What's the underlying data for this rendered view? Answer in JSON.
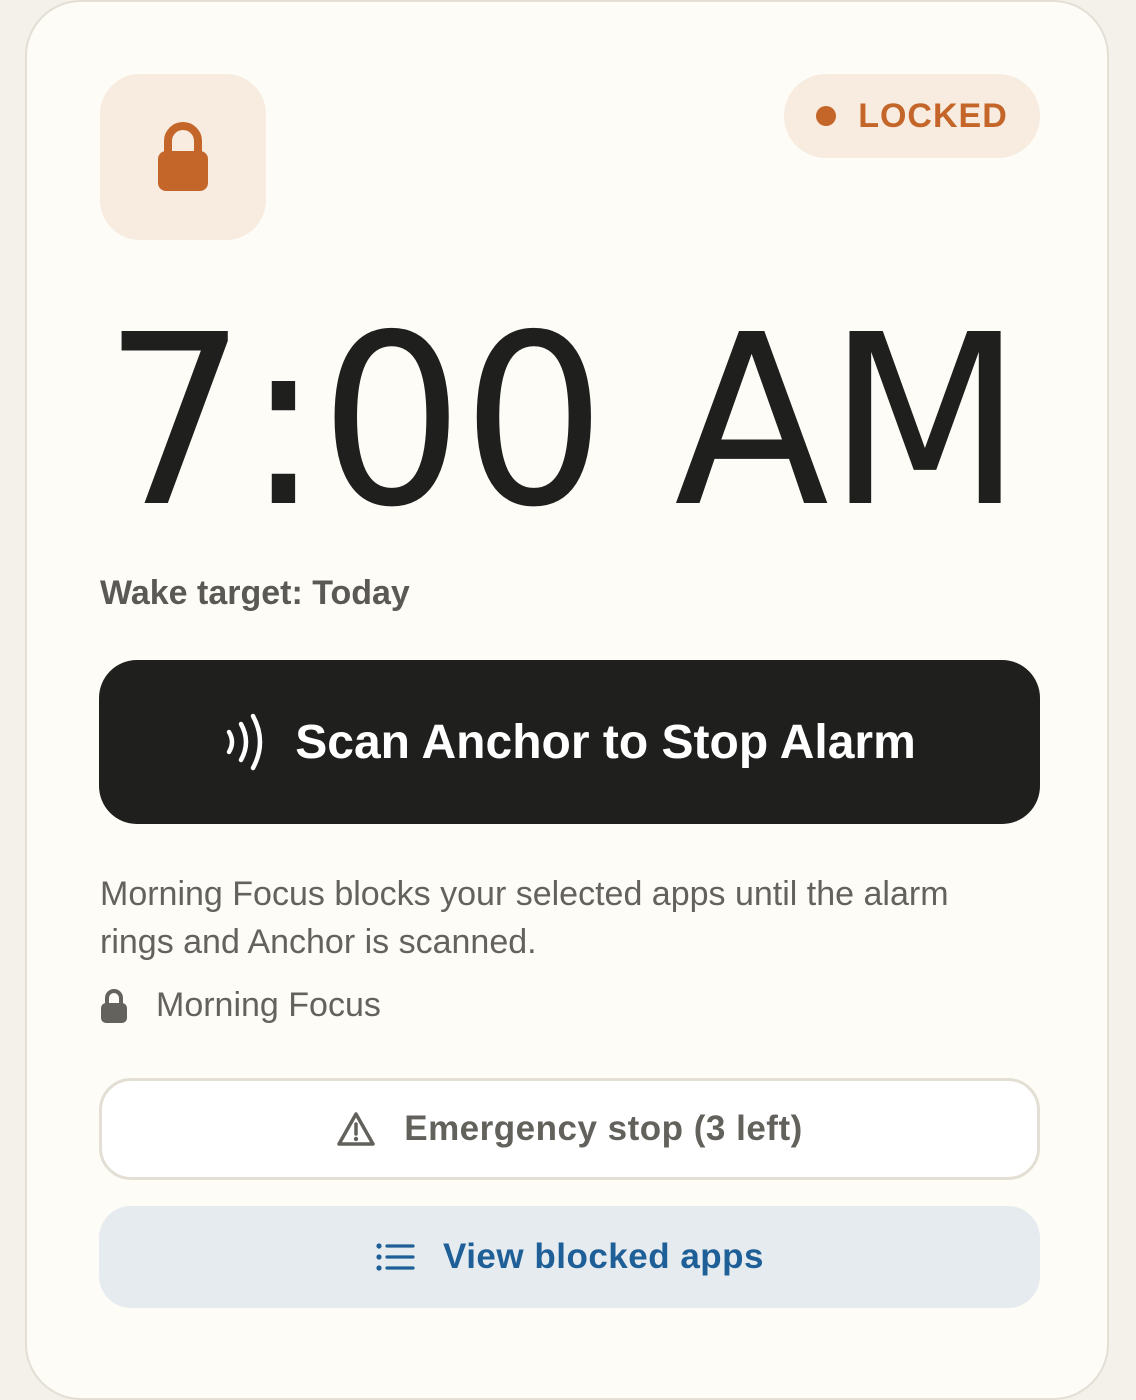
{
  "status": {
    "label": "LOCKED",
    "color": "#c4662a"
  },
  "alarm": {
    "time": "7:00 AM",
    "wake_target": "Wake target: Today"
  },
  "primary_action": {
    "label": "Scan Anchor to Stop Alarm",
    "icon": "nfc-wave-icon"
  },
  "description": "Morning Focus blocks your selected apps until the alarm rings and Anchor is scanned.",
  "focus_mode": {
    "icon": "lock-icon",
    "label": "Morning Focus"
  },
  "emergency": {
    "label": "Emergency stop (3 left)",
    "icon": "warning-triangle-icon"
  },
  "blocked_apps": {
    "label": "View blocked apps",
    "icon": "list-icon",
    "color": "#1f5f98"
  },
  "colors": {
    "accent": "#c4662a",
    "accent_bg": "#f8ebdf",
    "dark_button": "#1f1f1d",
    "card_bg": "#fdfcf6"
  }
}
